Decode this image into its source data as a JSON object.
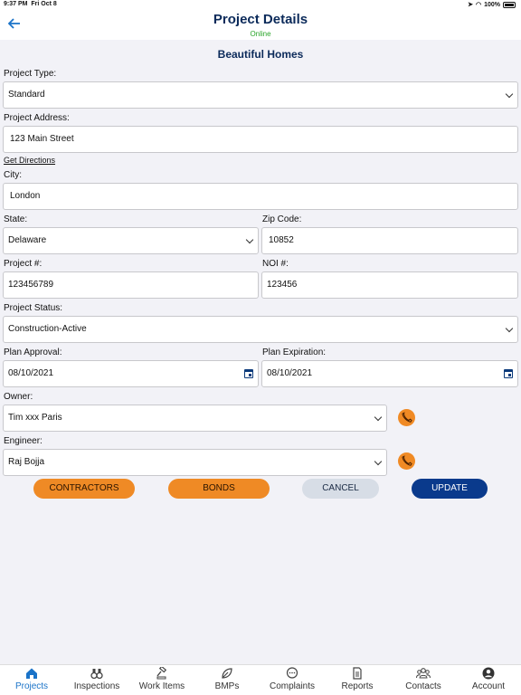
{
  "status_bar": {
    "time": "9:37 PM",
    "date": "Fri Oct 8",
    "battery": "100%"
  },
  "header": {
    "title": "Project Details",
    "subtitle": "Online",
    "back_icon": "back-arrow-icon"
  },
  "section_title": "Beautiful Homes",
  "form": {
    "project_type": {
      "label": "Project Type:",
      "value": "Standard"
    },
    "project_address": {
      "label": "Project Address:",
      "value": "123 Main Street"
    },
    "get_directions": "Get Directions",
    "city": {
      "label": "City:",
      "value": "London"
    },
    "state": {
      "label": "State:",
      "value": "Delaware"
    },
    "zip": {
      "label": "Zip Code:",
      "value": "10852"
    },
    "project_number": {
      "label": "Project #:",
      "value": "123456789"
    },
    "noi_number": {
      "label": "NOI #:",
      "value": "123456"
    },
    "project_status": {
      "label": "Project Status:",
      "value": "Construction-Active"
    },
    "plan_approval": {
      "label": "Plan Approval:",
      "value": "08/10/2021"
    },
    "plan_expiration": {
      "label": "Plan Expiration:",
      "value": "08/10/2021"
    },
    "owner": {
      "label": "Owner:",
      "value": "Tim xxx Paris"
    },
    "engineer": {
      "label": "Engineer:",
      "value": "Raj Bojja"
    }
  },
  "buttons": {
    "contractors": "CONTRACTORS",
    "bonds": "BONDS",
    "cancel": "CANCEL",
    "update": "UPDATE"
  },
  "colors": {
    "accent": "#1a73c8",
    "navy": "#0a3a8c",
    "orange": "#ef8a25",
    "online": "#2aa52a"
  },
  "tabs": [
    {
      "label": "Projects",
      "icon": "home-icon",
      "active": true
    },
    {
      "label": "Inspections",
      "icon": "binoculars-icon"
    },
    {
      "label": "Work Items",
      "icon": "gavel-icon"
    },
    {
      "label": "BMPs",
      "icon": "leaf-icon"
    },
    {
      "label": "Complaints",
      "icon": "chat-icon"
    },
    {
      "label": "Reports",
      "icon": "document-icon"
    },
    {
      "label": "Contacts",
      "icon": "group-icon"
    },
    {
      "label": "Account",
      "icon": "account-icon"
    }
  ]
}
